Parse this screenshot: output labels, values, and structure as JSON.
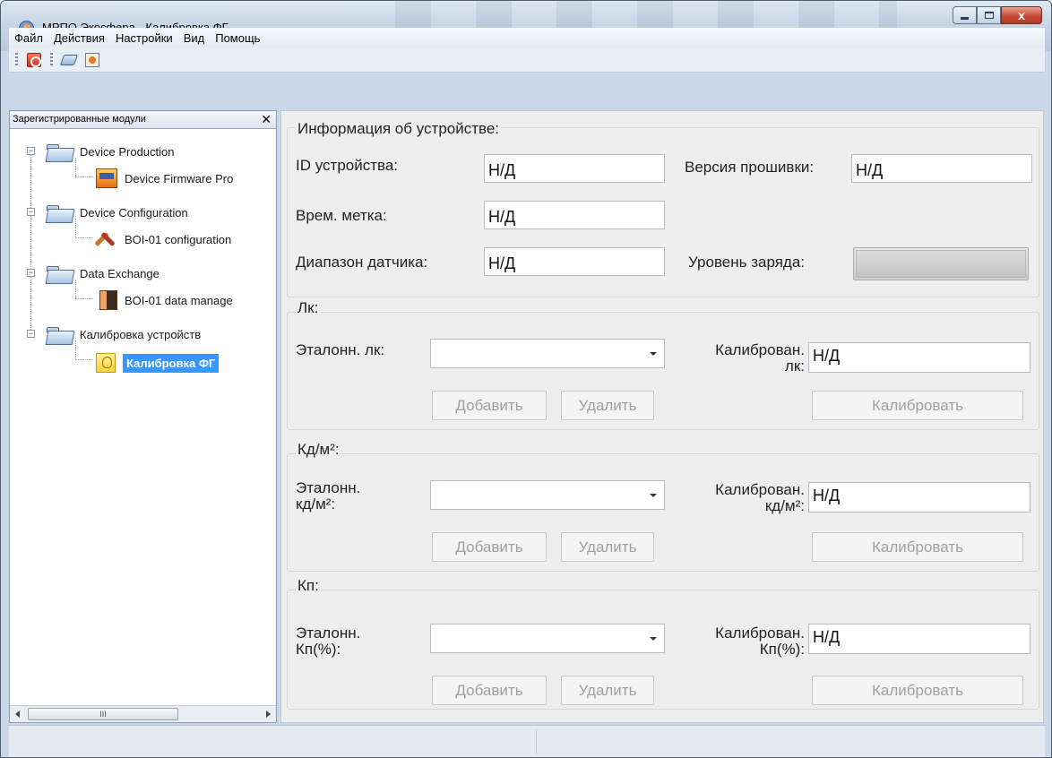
{
  "window": {
    "title": "МРПО Экосфера - Калибровка ФГ",
    "close_glyph": "x"
  },
  "menu": [
    "Файл",
    "Действия",
    "Настройки",
    "Вид",
    "Помощь"
  ],
  "toolbar": {
    "icons": [
      "power-icon",
      "eraser-icon",
      "export-icon"
    ]
  },
  "left_panel": {
    "title": "Зарегистрированные модули",
    "close_glyph": "✕",
    "scroll_thumb": "III",
    "tree": [
      {
        "label": "Device Production",
        "children": [
          {
            "label": "Device Firmware Pro",
            "icon": "firmware-icon"
          }
        ]
      },
      {
        "label": "Device Configuration",
        "children": [
          {
            "label": "BOI-01 configuration",
            "icon": "tools-icon"
          }
        ]
      },
      {
        "label": "Data Exchange",
        "children": [
          {
            "label": "BOI-01 data manage",
            "icon": "data-icon"
          }
        ]
      },
      {
        "label": "Калибровка устройств",
        "children": [
          {
            "label": "Калибровка ФГ",
            "icon": "bulb-icon",
            "selected": true
          }
        ]
      }
    ]
  },
  "device_info": {
    "title": "Информация об устройстве:",
    "id_label": "ID устройства:",
    "id_value": "Н/Д",
    "firmware_label": "Версия прошивки:",
    "firmware_value": "Н/Д",
    "timestamp_label": "Врем. метка:",
    "timestamp_value": "Н/Д",
    "range_label": "Диапазон датчика:",
    "range_value": "Н/Д",
    "charge_label": "Уровень заряда:"
  },
  "groups": [
    {
      "title": "Лк:",
      "ref_label": "Эталонн. лк:",
      "cal_label_1": "Калиброван.",
      "cal_label_2": "лк:",
      "cal_value": "Н/Д",
      "add": "Добавить",
      "remove": "Удалить",
      "calibrate": "Калибровать"
    },
    {
      "title": "Кд/м²:",
      "ref_label_1": "Эталонн.",
      "ref_label_2": "кд/м²:",
      "cal_label_1": "Калиброван.",
      "cal_label_2": "кд/м²:",
      "cal_value": "Н/Д",
      "add": "Добавить",
      "remove": "Удалить",
      "calibrate": "Калибровать"
    },
    {
      "title": "Кп:",
      "ref_label_1": "Эталонн.",
      "ref_label_2": "Кп(%):",
      "cal_label_1": "Калиброван.",
      "cal_label_2": "Кп(%):",
      "cal_value": "Н/Д",
      "add": "Добавить",
      "remove": "Удалить",
      "calibrate": "Калибровать"
    }
  ]
}
